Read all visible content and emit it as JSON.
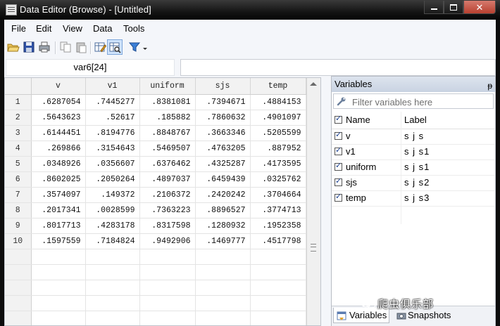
{
  "window": {
    "title": "Data Editor (Browse) - [Untitled]"
  },
  "menu": [
    "File",
    "Edit",
    "View",
    "Data",
    "Tools"
  ],
  "toolbar": {
    "icons": [
      "open-folder-icon",
      "save-icon",
      "print-icon",
      "copy-icon",
      "paste-icon",
      "data-editor-edit-icon",
      "data-editor-browse-icon",
      "filter-icon"
    ]
  },
  "cellbar": {
    "name": "var6[24]",
    "value": ""
  },
  "grid": {
    "columns": [
      "v",
      "v1",
      "uniform",
      "sjs",
      "temp"
    ],
    "rows": [
      [
        "1",
        ".6287054",
        ".7445277",
        ".8381081",
        ".7394671",
        ".4884153"
      ],
      [
        "2",
        ".5643623",
        ".52617",
        ".185882",
        ".7860632",
        ".4901097"
      ],
      [
        "3",
        ".6144451",
        ".8194776",
        ".8848767",
        ".3663346",
        ".5205599"
      ],
      [
        "4",
        ".269866",
        ".3154643",
        ".5469507",
        ".4763205",
        ".887952"
      ],
      [
        "5",
        ".0348926",
        ".0356607",
        ".6376462",
        ".4325287",
        ".4173595"
      ],
      [
        "6",
        ".8602025",
        ".2050264",
        ".4897037",
        ".6459439",
        ".0325762"
      ],
      [
        "7",
        ".3574097",
        ".149372",
        ".2106372",
        ".2420242",
        ".3704664"
      ],
      [
        "8",
        ".2017341",
        ".0028599",
        ".7363223",
        ".8896527",
        ".3774713"
      ],
      [
        "9",
        ".8017713",
        ".4283178",
        ".8317598",
        ".1280932",
        ".1952358"
      ],
      [
        "10",
        ".1597559",
        ".7184824",
        ".9492906",
        ".1469777",
        ".4517798"
      ]
    ]
  },
  "variables": {
    "header": "Variables",
    "pin": "ᵽ",
    "filter_placeholder": "Filter variables here",
    "col_name": "Name",
    "col_label": "Label",
    "items": [
      {
        "name": "v",
        "label": "s j s"
      },
      {
        "name": "v1",
        "label": "s j s1"
      },
      {
        "name": "uniform",
        "label": "s j s1"
      },
      {
        "name": "sjs",
        "label": "s j s2"
      },
      {
        "name": "temp",
        "label": "s j s3"
      }
    ],
    "tabs": [
      "Variables",
      "Snapshots"
    ]
  },
  "watermark": "爬虫俱乐部"
}
